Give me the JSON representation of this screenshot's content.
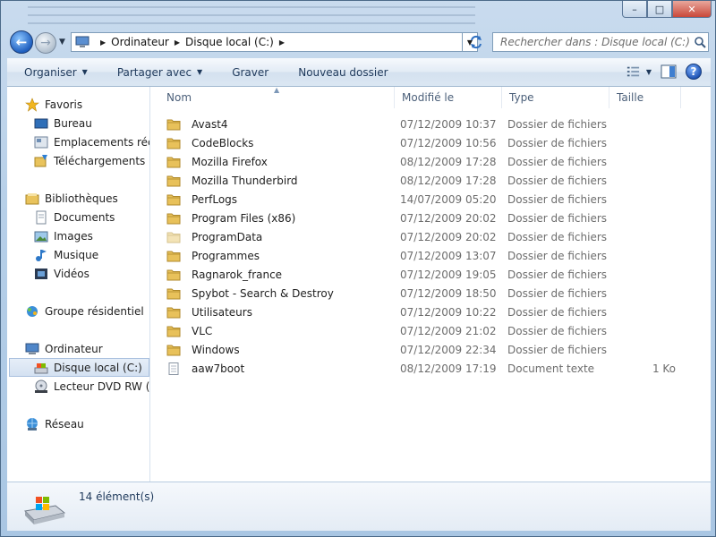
{
  "window": {
    "caption": {
      "minimize": "–",
      "maximize": "□",
      "close": "✕"
    }
  },
  "nav": {
    "back_icon": "back-arrow-icon",
    "forward_icon": "forward-arrow-icon"
  },
  "address": {
    "crumbs": [
      "Ordinateur",
      "Disque local (C:)"
    ]
  },
  "search": {
    "placeholder": "Rechercher dans : Disque local (C:)"
  },
  "toolbar": {
    "organize": "Organiser",
    "share": "Partager avec",
    "burn": "Graver",
    "new_folder": "Nouveau dossier"
  },
  "sidebar": {
    "favorites": "Favoris",
    "desktop": "Bureau",
    "recent": "Emplacements récents",
    "downloads": "Téléchargements",
    "libraries": "Bibliothèques",
    "documents": "Documents",
    "images": "Images",
    "music": "Musique",
    "videos": "Vidéos",
    "homegroup": "Groupe résidentiel",
    "computer": "Ordinateur",
    "local_disk": "Disque local (C:)",
    "dvd": "Lecteur DVD RW (D:)",
    "network": "Réseau"
  },
  "columns": {
    "name": "Nom",
    "modified": "Modifié le",
    "type": "Type",
    "size": "Taille"
  },
  "files": [
    {
      "name": "Avast4",
      "modified": "07/12/2009 10:37",
      "type": "Dossier de fichiers",
      "size": "",
      "kind": "folder"
    },
    {
      "name": "CodeBlocks",
      "modified": "07/12/2009 10:56",
      "type": "Dossier de fichiers",
      "size": "",
      "kind": "folder"
    },
    {
      "name": "Mozilla Firefox",
      "modified": "08/12/2009 17:28",
      "type": "Dossier de fichiers",
      "size": "",
      "kind": "folder"
    },
    {
      "name": "Mozilla Thunderbird",
      "modified": "08/12/2009 17:28",
      "type": "Dossier de fichiers",
      "size": "",
      "kind": "folder"
    },
    {
      "name": "PerfLogs",
      "modified": "14/07/2009 05:20",
      "type": "Dossier de fichiers",
      "size": "",
      "kind": "folder"
    },
    {
      "name": "Program Files (x86)",
      "modified": "07/12/2009 20:02",
      "type": "Dossier de fichiers",
      "size": "",
      "kind": "folder"
    },
    {
      "name": "ProgramData",
      "modified": "07/12/2009 20:02",
      "type": "Dossier de fichiers",
      "size": "",
      "kind": "hidden-folder"
    },
    {
      "name": "Programmes",
      "modified": "07/12/2009 13:07",
      "type": "Dossier de fichiers",
      "size": "",
      "kind": "folder"
    },
    {
      "name": "Ragnarok_france",
      "modified": "07/12/2009 19:05",
      "type": "Dossier de fichiers",
      "size": "",
      "kind": "folder"
    },
    {
      "name": "Spybot - Search & Destroy",
      "modified": "07/12/2009 18:50",
      "type": "Dossier de fichiers",
      "size": "",
      "kind": "folder"
    },
    {
      "name": "Utilisateurs",
      "modified": "07/12/2009 10:22",
      "type": "Dossier de fichiers",
      "size": "",
      "kind": "folder"
    },
    {
      "name": "VLC",
      "modified": "07/12/2009 21:02",
      "type": "Dossier de fichiers",
      "size": "",
      "kind": "folder"
    },
    {
      "name": "Windows",
      "modified": "07/12/2009 22:34",
      "type": "Dossier de fichiers",
      "size": "",
      "kind": "folder"
    },
    {
      "name": "aaw7boot",
      "modified": "08/12/2009 17:19",
      "type": "Document texte",
      "size": "1 Ko",
      "kind": "text"
    }
  ],
  "details": {
    "count": "14 élément(s)"
  },
  "colors": {
    "accent": "#1e395b",
    "folder": "#e8c15a",
    "selection": "#d4e1f1"
  }
}
